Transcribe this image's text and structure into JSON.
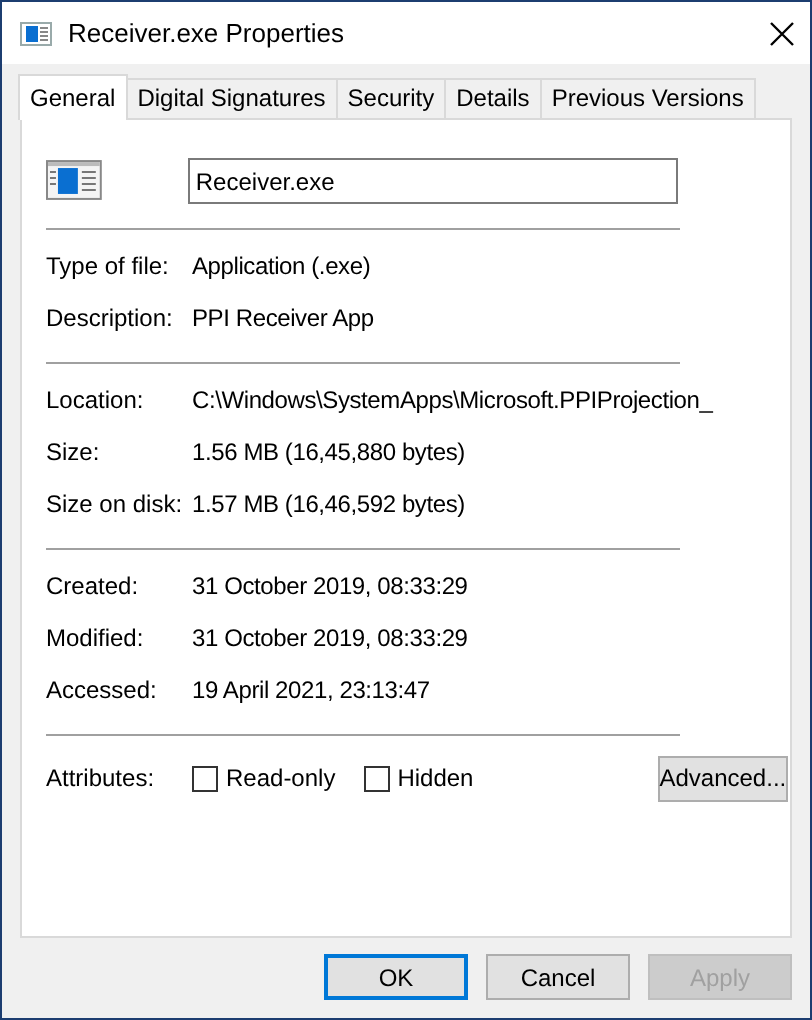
{
  "window": {
    "title": "Receiver.exe Properties"
  },
  "tabs": [
    {
      "label": "General",
      "selected": true
    },
    {
      "label": "Digital Signatures",
      "selected": false
    },
    {
      "label": "Security",
      "selected": false
    },
    {
      "label": "Details",
      "selected": false
    },
    {
      "label": "Previous Versions",
      "selected": false
    }
  ],
  "file_name": {
    "value": "Receiver.exe"
  },
  "sections": [
    [
      {
        "label": "Type of file:",
        "value": "Application (.exe)"
      },
      {
        "label": "Description:",
        "value": "PPI Receiver App"
      }
    ],
    [
      {
        "label": "Location:",
        "value": "C:\\Windows\\SystemApps\\Microsoft.PPIProjection_"
      },
      {
        "label": "Size:",
        "value": "1.56 MB (16,45,880 bytes)"
      },
      {
        "label": "Size on disk:",
        "value": "1.57 MB (16,46,592 bytes)"
      }
    ],
    [
      {
        "label": "Created:",
        "value": "31 October 2019, 08:33:29"
      },
      {
        "label": "Modified:",
        "value": "31 October 2019, 08:33:29"
      },
      {
        "label": "Accessed:",
        "value": "19 April 2021, 23:13:47"
      }
    ]
  ],
  "attributes": {
    "label": "Attributes:",
    "checkboxes": [
      {
        "label": "Read-only",
        "checked": false
      },
      {
        "label": "Hidden",
        "checked": false
      }
    ],
    "button": "Advanced..."
  },
  "buttons": [
    {
      "label": "OK",
      "kind": "default"
    },
    {
      "label": "Cancel",
      "kind": "normal"
    },
    {
      "label": "Apply",
      "kind": "disabled"
    }
  ]
}
